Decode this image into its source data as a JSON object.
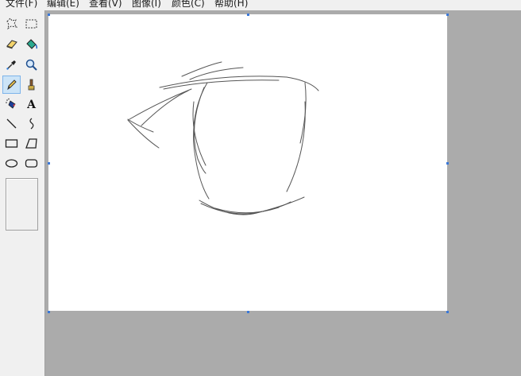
{
  "menu": {
    "items": [
      {
        "label": "文件(F)"
      },
      {
        "label": "编辑(E)"
      },
      {
        "label": "查看(V)"
      },
      {
        "label": "图像(I)"
      },
      {
        "label": "颜色(C)"
      },
      {
        "label": "帮助(H)"
      }
    ]
  },
  "toolbox": {
    "tools": [
      {
        "name": "free-form-select",
        "icon": "free-form-select-icon",
        "active": false
      },
      {
        "name": "select",
        "icon": "select-icon",
        "active": false
      },
      {
        "name": "eraser",
        "icon": "eraser-icon",
        "active": false
      },
      {
        "name": "fill-with-color",
        "icon": "fill-bucket-icon",
        "active": false
      },
      {
        "name": "pick-color",
        "icon": "eyedropper-icon",
        "active": false
      },
      {
        "name": "magnifier",
        "icon": "magnifier-icon",
        "active": false
      },
      {
        "name": "pencil",
        "icon": "pencil-icon",
        "active": true
      },
      {
        "name": "brush",
        "icon": "brush-icon",
        "active": false
      },
      {
        "name": "airbrush",
        "icon": "airbrush-icon",
        "active": false
      },
      {
        "name": "text",
        "icon": "text-icon",
        "active": false
      },
      {
        "name": "line",
        "icon": "line-icon",
        "active": false
      },
      {
        "name": "curve",
        "icon": "curve-icon",
        "active": false
      },
      {
        "name": "rectangle",
        "icon": "rectangle-icon",
        "active": false
      },
      {
        "name": "polygon",
        "icon": "polygon-icon",
        "active": false
      },
      {
        "name": "ellipse",
        "icon": "ellipse-icon",
        "active": false
      },
      {
        "name": "rounded-rectangle",
        "icon": "rounded-rectangle-icon",
        "active": false
      }
    ]
  },
  "colors": {
    "ui_background": "#f0f0f0",
    "workspace": "#ababab",
    "canvas": "#ffffff",
    "handle": "#3a78d8",
    "active_tool": "#cce4f7",
    "stroke": "#555555"
  }
}
